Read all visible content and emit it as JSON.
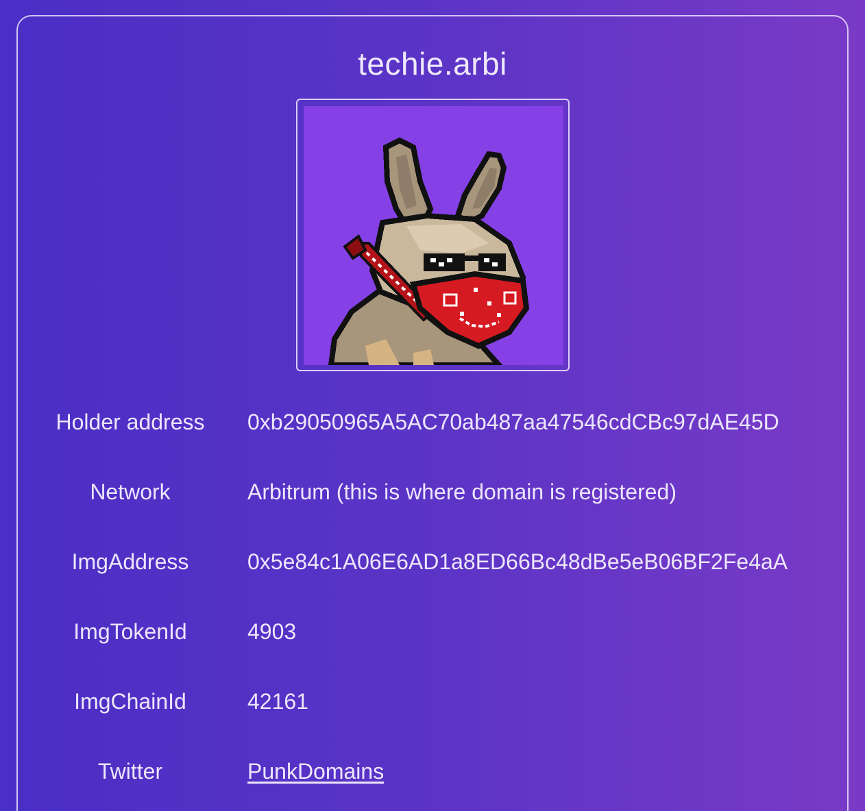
{
  "domain": {
    "name": "techie.arbi"
  },
  "image": {
    "alt": "pixel rabbit with sunglasses and red bandana",
    "background_color": "#8540e6",
    "bandana_color": "#d61a22"
  },
  "details": [
    {
      "label": "Holder address",
      "value": "0xb29050965A5AC70ab487aa47546cdCBc97dAE45D"
    },
    {
      "label": "Network",
      "value": "Arbitrum (this is where domain is registered)"
    },
    {
      "label": "ImgAddress",
      "value": "0x5e84c1A06E6AD1a8ED66Bc48dBe5eB06BF2Fe4aA"
    },
    {
      "label": "ImgTokenId",
      "value": "4903"
    },
    {
      "label": "ImgChainId",
      "value": "42161"
    },
    {
      "label": "Twitter",
      "value": "PunkDomains"
    }
  ],
  "colors": {
    "background_start": "#4a2ec5",
    "background_end": "#7a3ac6",
    "text": "#ece6fb"
  }
}
